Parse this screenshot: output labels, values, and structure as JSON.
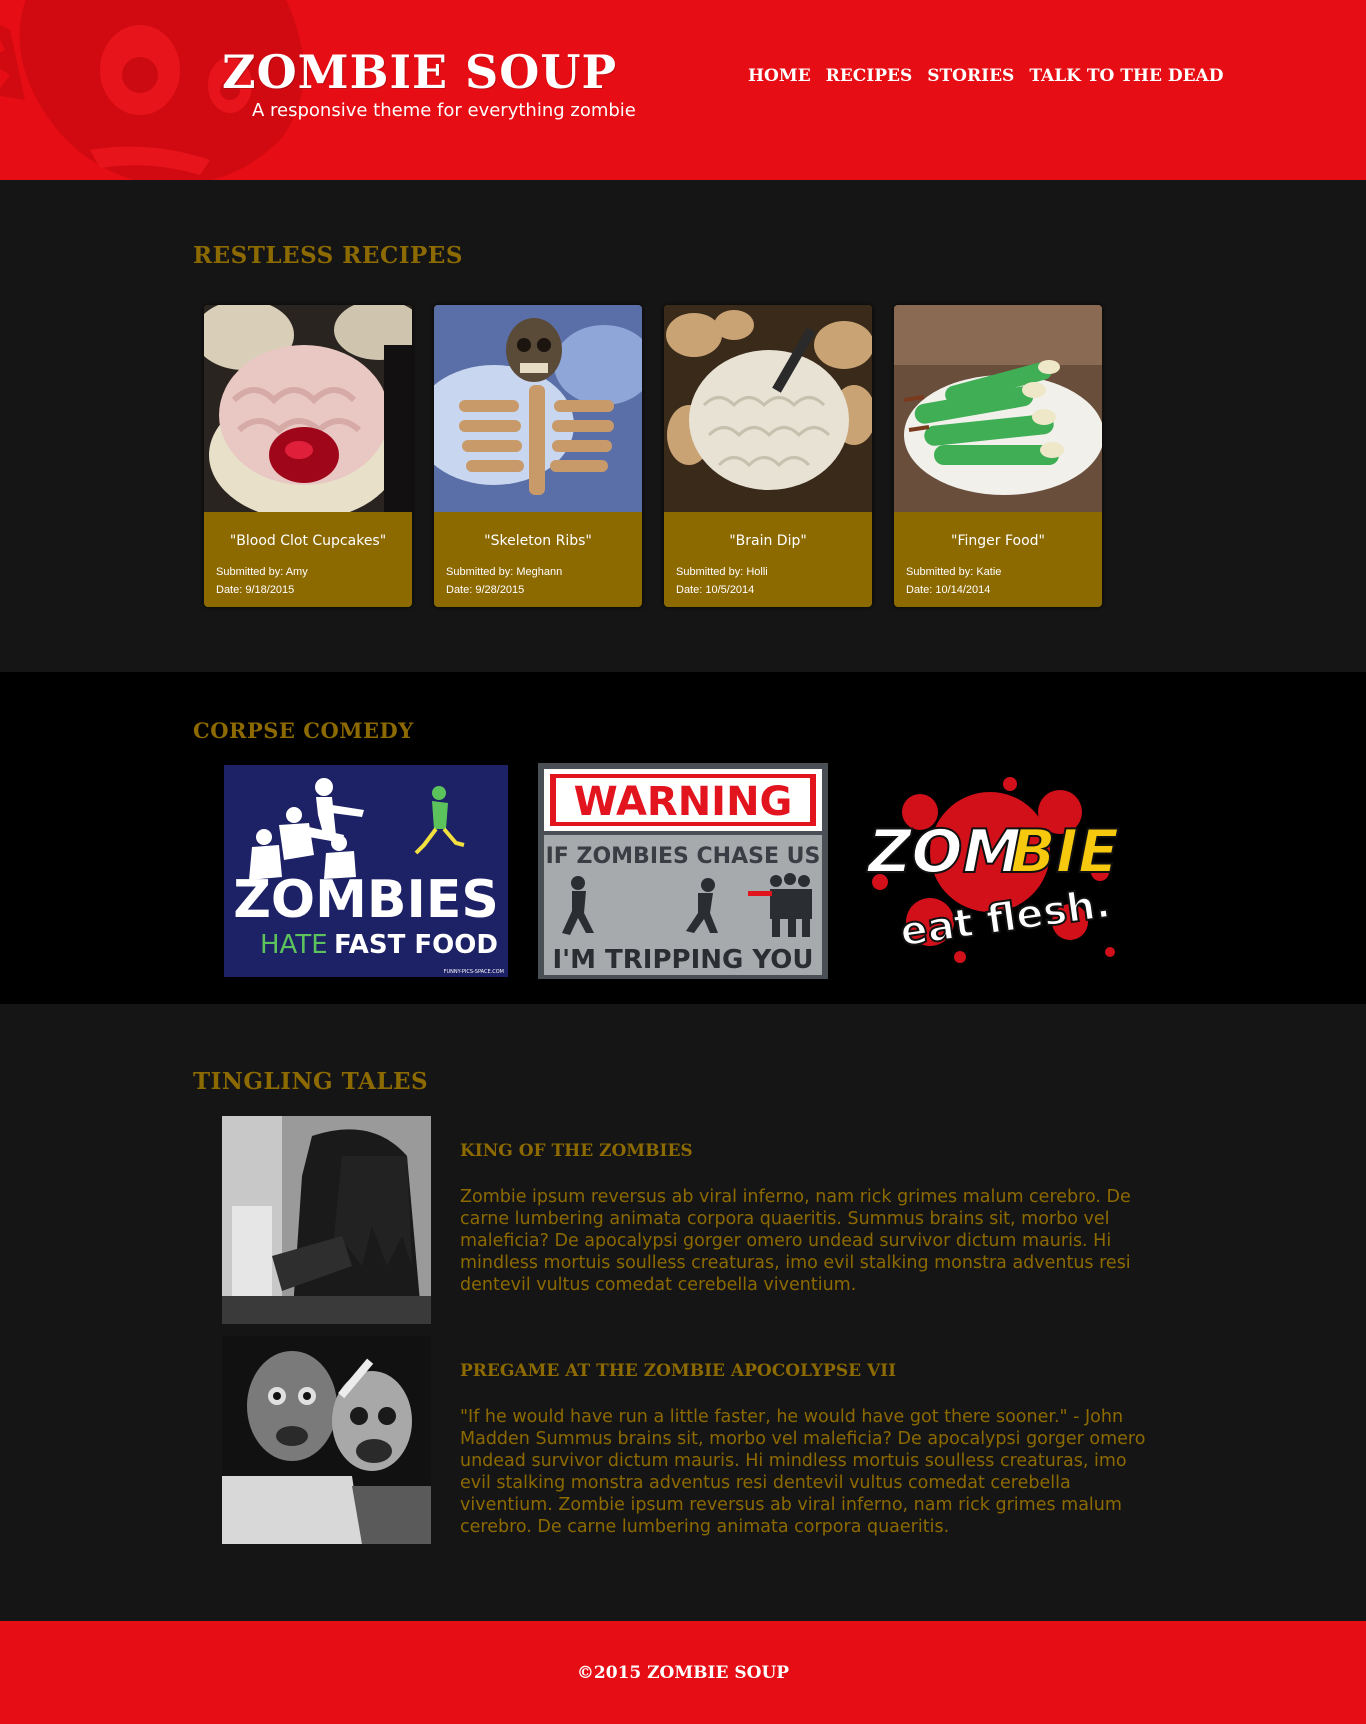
{
  "colors": {
    "header_red": "#e60d14",
    "gold": "#8d6a00",
    "dark_bg": "#151515",
    "black_bg": "#000000"
  },
  "header": {
    "logo": "ZOMBIE SOUP",
    "tagline": "A responsive theme for everything zombie",
    "nav": [
      "HOME",
      "RECIPES",
      "STORIES",
      "TALK TO THE DEAD"
    ]
  },
  "recipes": {
    "title": "RESTLESS RECIPES",
    "items": [
      {
        "name": "\"Blood Clot Cupcakes\"",
        "submitted": "Submitted by: Amy",
        "date": "Date: 9/18/2015",
        "image": "cupcake-photo"
      },
      {
        "name": "\"Skeleton Ribs\"",
        "submitted": "Submitted by: Meghann",
        "date": "Date: 9/28/2015",
        "image": "skeleton-ribs-photo"
      },
      {
        "name": "\"Brain Dip\"",
        "submitted": "Submitted by: Holli",
        "date": "Date: 10/5/2014",
        "image": "brain-dip-photo"
      },
      {
        "name": "\"Finger Food\"",
        "submitted": "Submitted by: Katie",
        "date": "Date: 10/14/2014",
        "image": "finger-food-photo"
      }
    ]
  },
  "comedy": {
    "title": "CORPSE COMEDY",
    "memes": [
      {
        "line1": "ZOMBIES",
        "line2a": "HATE",
        "line2b": "FAST FOOD",
        "credit": "FUNNY-PICS-SPACE.COM"
      },
      {
        "warning": "WARNING",
        "line1": "IF ZOMBIES CHASE US",
        "line2": "I'M TRIPPING YOU"
      },
      {
        "zom": "ZOM",
        "bie": "BIE",
        "tail": "eat flesh."
      }
    ]
  },
  "stories": {
    "title": "TINGLING TALES",
    "items": [
      {
        "title": "KING OF THE ZOMBIES",
        "text": "Zombie ipsum reversus ab viral inferno, nam rick grimes malum cerebro. De carne lumbering animata corpora quaeritis. Summus brains sit, morbo vel maleficia? De apocalypsi gorger omero undead survivor dictum mauris. Hi mindless mortuis soulless creaturas, imo evil stalking monstra adventus resi dentevil vultus comedat cerebella viventium."
      },
      {
        "title": "PREGAME AT THE ZOMBIE APOCOLYPSE VII",
        "text": "\"If he would have run a little faster, he would have got there sooner.\" - John Madden Summus brains sit, morbo vel maleficia? De apocalypsi gorger omero undead survivor dictum mauris. Hi mindless mortuis soulless creaturas, imo evil stalking monstra adventus resi dentevil vultus comedat cerebella viventium. Zombie ipsum reversus ab viral inferno, nam rick grimes malum cerebro. De carne lumbering animata corpora quaeritis."
      }
    ]
  },
  "footer": {
    "copyright": "©2015 ZOMBIE SOUP"
  }
}
